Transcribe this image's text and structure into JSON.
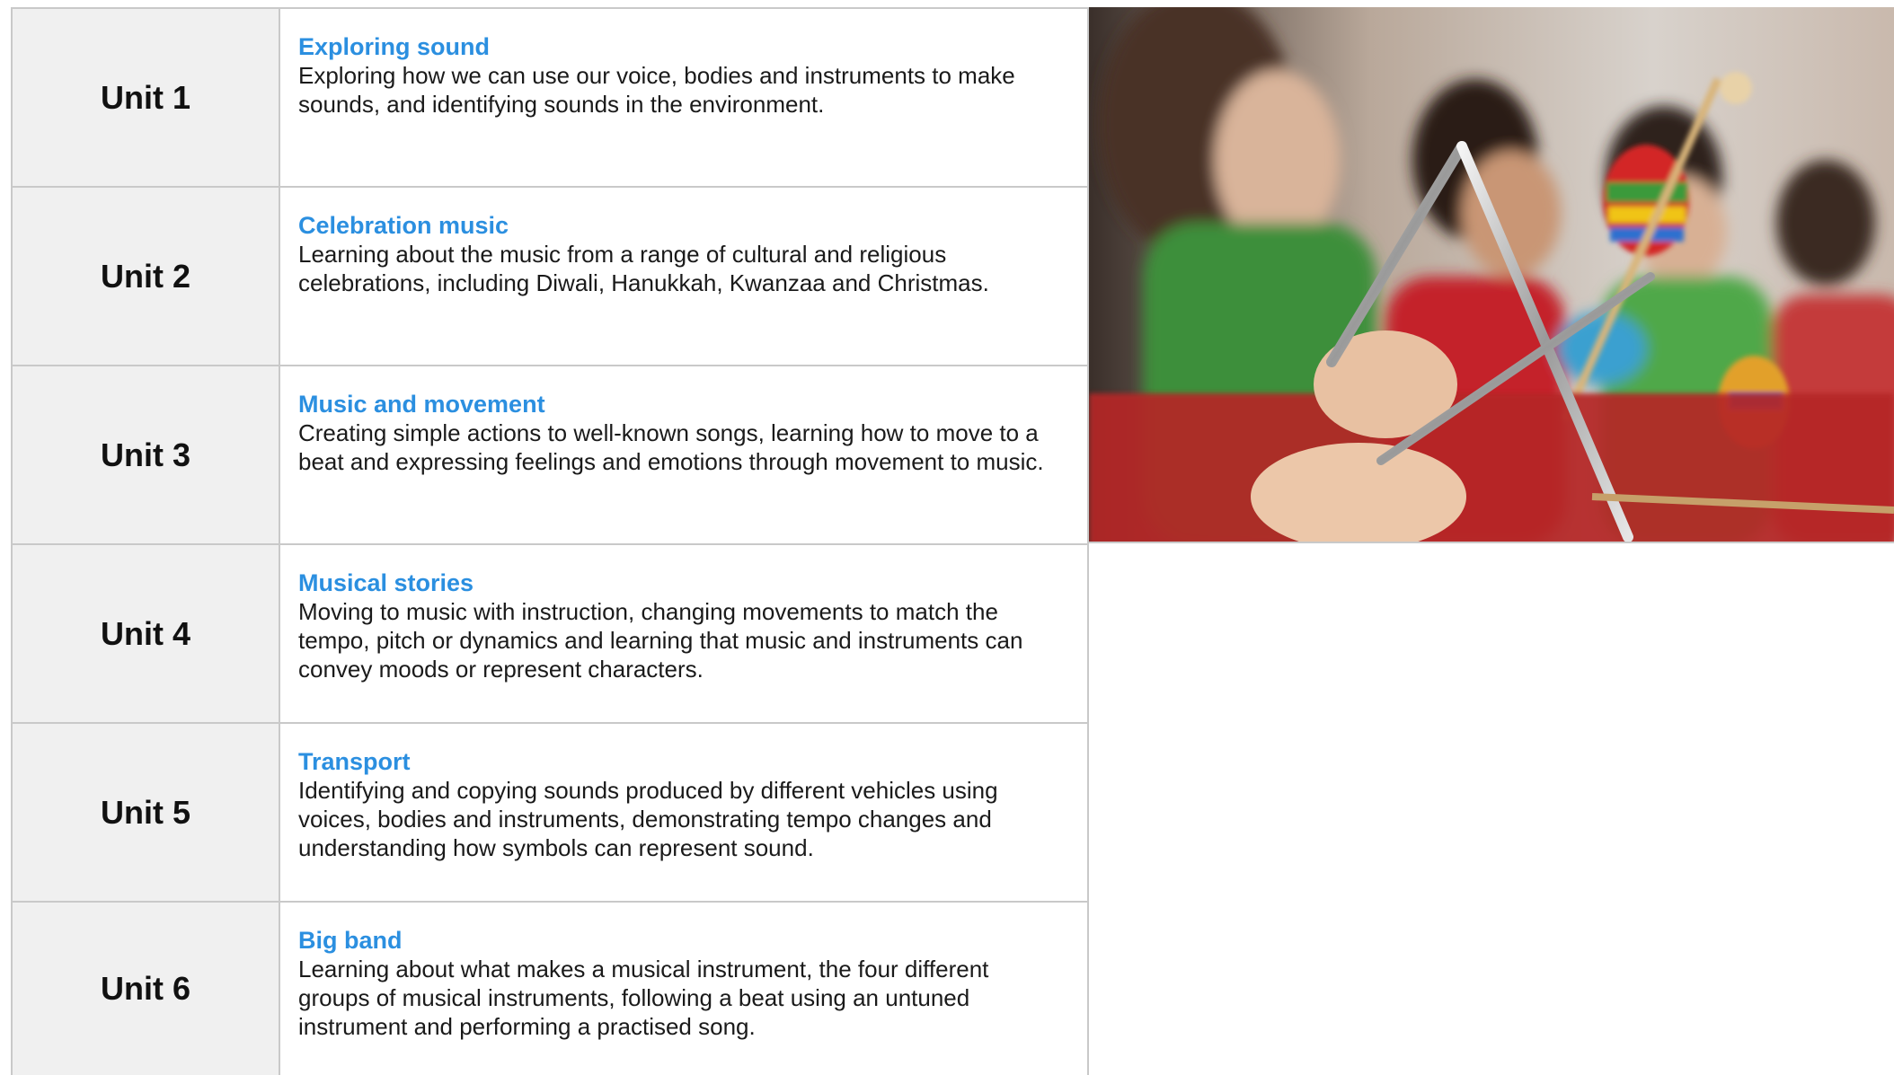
{
  "units": [
    {
      "label": "Unit 1",
      "title": "Exploring sound",
      "description": "Exploring how we can use our voice, bodies and instruments to make sounds, and identifying sounds in the environment."
    },
    {
      "label": "Unit 2",
      "title": "Celebration music",
      "description": "Learning about the music from a range of cultural and religious celebrations, including Diwali, Hanukkah, Kwanzaa and Christmas."
    },
    {
      "label": "Unit 3",
      "title": "Music and movement",
      "description": "Creating simple actions to well-known songs, learning how to move to a beat and expressing feelings and emotions through movement to music."
    },
    {
      "label": "Unit 4",
      "title": "Musical stories",
      "description": "Moving to music with instruction, changing movements to match the tempo, pitch or dynamics and learning that music and instruments can convey moods or represent characters."
    },
    {
      "label": "Unit 5",
      "title": "Transport",
      "description": "Identifying  and copying sounds produced by different vehicles using voices, bodies and instruments, demonstrating tempo changes and understanding how symbols can represent sound."
    },
    {
      "label": "Unit 6",
      "title": "Big band",
      "description": "Learning about what makes a musical instrument, the four different groups of musical instruments, following a beat using an untuned instrument and performing a practised song."
    }
  ],
  "colors": {
    "title_accent": "#2b8fe0",
    "label_cell_bg": "#f0f0f0",
    "border": "#c9c9c9"
  },
  "photo": {
    "subject": "children-playing-triangle-and-instruments"
  }
}
